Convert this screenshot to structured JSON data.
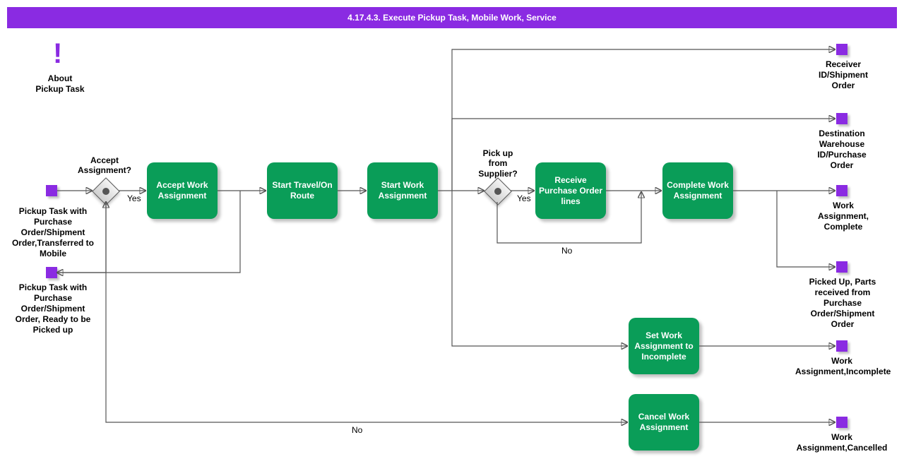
{
  "title": "4.17.4.3. Execute Pickup Task, Mobile Work, Service",
  "annotation": {
    "line1": "About",
    "line2": "Pickup Task"
  },
  "start1": "Pickup Task with Purchase Order/Shipment Order,Transferred to Mobile",
  "start2": "Pickup Task with Purchase Order/Shipment Order, Ready to be Picked up",
  "gw1": {
    "label": "Accept Assignment?",
    "yes": "Yes",
    "no": "No"
  },
  "gw2": {
    "label": "Pick up from Supplier?",
    "yes": "Yes",
    "no": "No"
  },
  "tasks": {
    "accept": "Accept Work Assignment",
    "travel": "Start Travel/On Route",
    "startwork": "Start Work Assignment",
    "receive": "Receive Purchase Order lines",
    "complete": "Complete Work Assignment",
    "incomplete": "Set Work Assignment to Incomplete",
    "cancel": "Cancel Work Assignment"
  },
  "ends": {
    "receiver": "Receiver ID/Shipment Order",
    "destwh": "Destination Warehouse ID/Purchase Order",
    "waComplete": "Work Assignment, Complete",
    "picked": "Picked Up, Parts received from Purchase Order/Shipment Order",
    "waIncomplete": "Work Assignment,Incomplete",
    "waCancelled": "Work Assignment,Cancelled"
  }
}
